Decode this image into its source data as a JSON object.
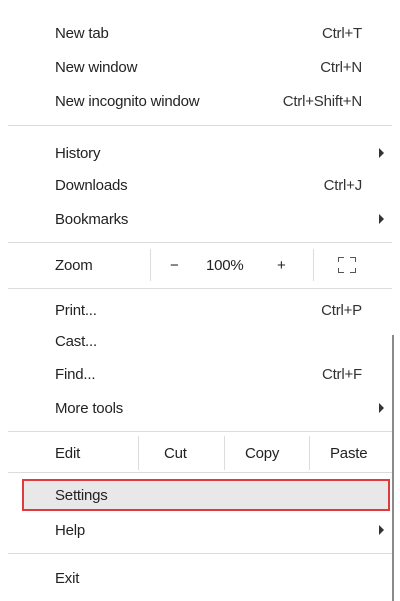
{
  "menu": {
    "new_tab": {
      "label": "New tab",
      "shortcut": "Ctrl+T"
    },
    "new_window": {
      "label": "New window",
      "shortcut": "Ctrl+N"
    },
    "new_incognito": {
      "label": "New incognito window",
      "shortcut": "Ctrl+Shift+N"
    },
    "history": {
      "label": "History"
    },
    "downloads": {
      "label": "Downloads",
      "shortcut": "Ctrl+J"
    },
    "bookmarks": {
      "label": "Bookmarks"
    },
    "zoom": {
      "label": "Zoom",
      "minus": "−",
      "value": "100%",
      "plus": "+"
    },
    "print": {
      "label": "Print...",
      "shortcut": "Ctrl+P"
    },
    "cast": {
      "label": "Cast..."
    },
    "find": {
      "label": "Find...",
      "shortcut": "Ctrl+F"
    },
    "more_tools": {
      "label": "More tools"
    },
    "edit": {
      "label": "Edit",
      "cut": "Cut",
      "copy": "Copy",
      "paste": "Paste"
    },
    "settings": {
      "label": "Settings",
      "highlighted": true
    },
    "help": {
      "label": "Help"
    },
    "exit": {
      "label": "Exit"
    }
  },
  "colors": {
    "highlight_border": "#e0393e",
    "highlight_fill": "#e8e8e8",
    "separator": "#dcdcdc"
  }
}
